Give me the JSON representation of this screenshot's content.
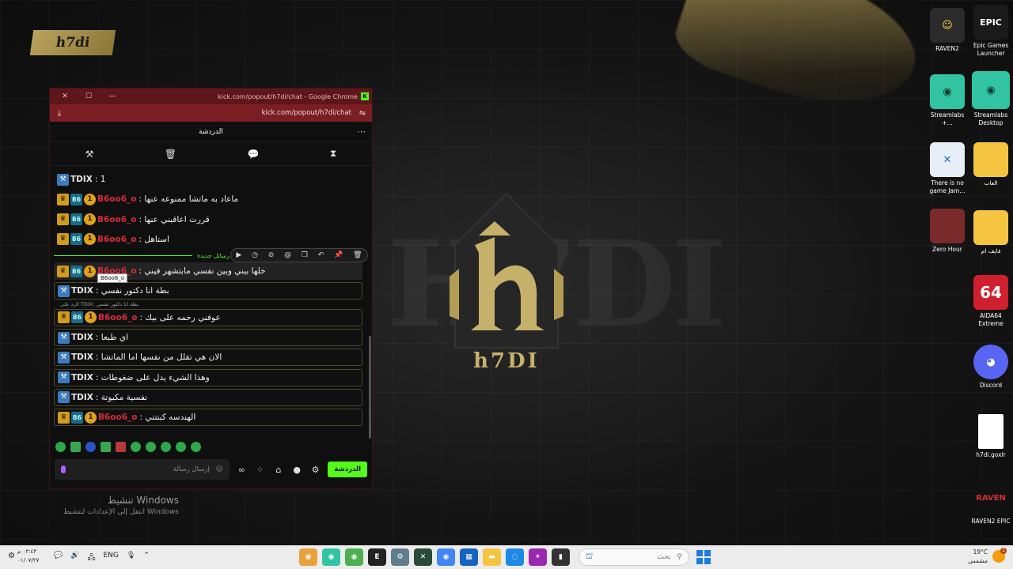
{
  "desktop": {
    "brand_tag": "h7di",
    "center_logo_text": "h7DI",
    "watermark_text": "H7DI",
    "activate_title": "تنشيط Windows",
    "activate_subtitle": "انتقل إلى الإعدادات لتنشيط Windows",
    "icons": [
      {
        "label": "RAVEN2",
        "color": "#2b2b2b"
      },
      {
        "label": "Epic Games Launcher",
        "color": "#1a1a1a"
      },
      {
        "label": "Streamlabs +...",
        "color": "#31c3a2"
      },
      {
        "label": "Streamlabs Desktop",
        "color": "#31c3a2"
      },
      {
        "label": "There is no game Jam...",
        "color": "#1e6fd9"
      },
      {
        "label": "العاب",
        "color": "#f5c542"
      },
      {
        "label": "Zero Hour",
        "color": "#7a2a2a"
      },
      {
        "label": "فايف ام",
        "color": "#f5c542"
      },
      {
        "label": "AIDA64 Extreme",
        "color": "#d01f2e"
      },
      {
        "label": "Discord",
        "color": "#5865f2"
      },
      {
        "label": "h7di.goxlr",
        "color": "#ffffff"
      },
      {
        "label": "RAVEN2 EPIC",
        "color": "#111111"
      }
    ]
  },
  "window": {
    "title": "kick.com/popout/h7di/chat - Google Chrome",
    "url": "kick.com/popout/h7di/chat",
    "chat_title": "الدردشة",
    "new_messages_label": "رسائل جديدة",
    "tooltip": "B6oo6_o",
    "reply_hint": "الرد على TDIX: بطة انا دكتور نفسي",
    "input_placeholder": "إرسال رسالة",
    "send_label": "الدردشة",
    "messages_before": [
      {
        "user": "TDIX",
        "text": "1",
        "type": "mod"
      },
      {
        "user": "B6oo6_o",
        "text": "ماعاد به ماتشا ممنوعه عنها",
        "type": "sub"
      },
      {
        "user": "B6oo6_o",
        "text": "قررت اعاقبني عنها",
        "type": "sub"
      },
      {
        "user": "B6oo6_o",
        "text": "استاهل",
        "type": "sub"
      }
    ],
    "messages_after": [
      {
        "user": "B6oo6_o",
        "text": "خلها بيني وبين نفسي مابتشهر فيني",
        "type": "sub",
        "style": "hl"
      },
      {
        "user": "TDIX",
        "text": "بطة انا دكتور نفسي",
        "type": "mod",
        "style": "boxed"
      },
      {
        "user": "B6oo6_o",
        "text": "عوفني رحمه على بيك",
        "type": "sub",
        "style": "reply"
      },
      {
        "user": "TDIX",
        "text": "اي طبعا",
        "type": "mod",
        "style": "boxed"
      },
      {
        "user": "TDIX",
        "text": "الان هي تقلل من نفسها اما الماتشا",
        "type": "mod",
        "style": "boxed"
      },
      {
        "user": "TDIX",
        "text": "وهذا الشيء يدل على ضغوطات",
        "type": "mod",
        "style": "boxed"
      },
      {
        "user": "TDIX",
        "text": "نفسية مكبوتة",
        "type": "mod",
        "style": "boxed"
      },
      {
        "user": "B6oo6_o",
        "text": "الهندسه كبتتني",
        "type": "sub",
        "style": "boxed"
      }
    ]
  },
  "taskbar": {
    "time": "٠٣:٤٣ م",
    "date": "٠١/٠٧/٢٧",
    "lang": "ENG",
    "search_placeholder": "بحث",
    "weather_temp": "19°C",
    "weather_desc": "مشمس",
    "notif_count": "1"
  }
}
